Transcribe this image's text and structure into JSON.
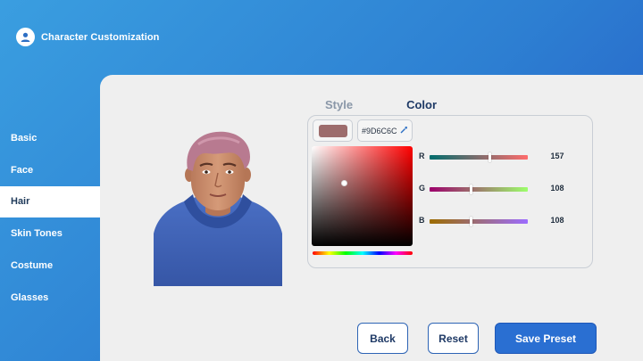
{
  "header": {
    "title": "Character Customization",
    "icon": "user-icon"
  },
  "sidebar": {
    "items": [
      {
        "label": "Basic"
      },
      {
        "label": "Face"
      },
      {
        "label": "Hair",
        "active": true
      },
      {
        "label": "Skin Tones"
      },
      {
        "label": "Costume"
      },
      {
        "label": "Glasses"
      }
    ]
  },
  "tabs": {
    "style_label": "Style",
    "color_label": "Color",
    "active": "Color"
  },
  "color_picker": {
    "swatch_color": "#9D6C6C",
    "hex_value": "#9D6C6C",
    "hex_icon": "eyedropper-icon",
    "channels": [
      {
        "label": "R",
        "value": "157",
        "fraction": 0.616
      },
      {
        "label": "G",
        "value": "108",
        "fraction": 0.424
      },
      {
        "label": "B",
        "value": "108",
        "fraction": 0.424
      }
    ]
  },
  "buttons": {
    "back": "Back",
    "reset": "Reset",
    "save": "Save Preset"
  },
  "colors": {
    "accent": "#2A6FD2",
    "hair": "#B87A90",
    "hoodie": "#3E63B4",
    "skin": "#C98C6C"
  }
}
